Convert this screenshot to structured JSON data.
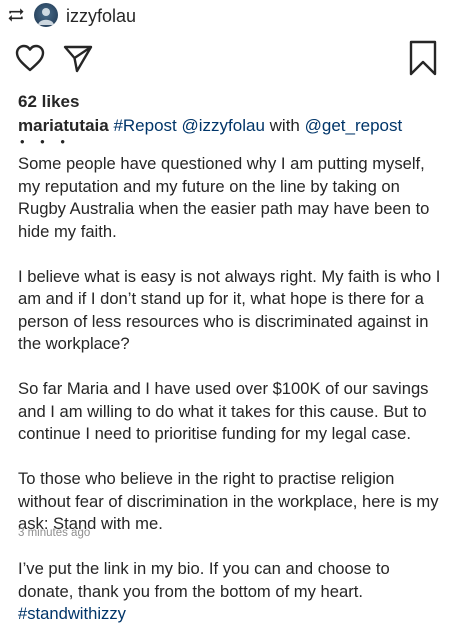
{
  "header": {
    "repost_icon": "repost-icon",
    "username": "izzyfolau"
  },
  "actions": {
    "like_icon": "heart-icon",
    "share_icon": "send-icon",
    "save_icon": "bookmark-icon"
  },
  "likes": "62 likes",
  "caption": {
    "user": "mariatutaia",
    "tag1": "#Repost",
    "mention1": "@izzyfolau",
    "with_text": "with",
    "mention2": "@get_repost",
    "more": "• • •",
    "paragraphs": [
      "Some people have questioned why I am putting myself, my reputation and my future on the line by taking on Rugby Australia when the easier path may have been to hide my faith.",
      "I believe what is easy is not always right. My faith is who I am and if I don’t stand up for it, what hope is there for a person of less resources who is discriminated against in the workplace?",
      "So far Maria and I have used over $100K of our savings and I am willing to do what it takes for this cause. But to continue I need to prioritise funding for my legal case.",
      "To those who believe in the right to practise religion without fear of discrimination in the workplace, here is my ask: Stand with me."
    ],
    "last_paragraph": "I’ve put the link in my bio. If you can and choose to donate, thank you from the bottom of my heart.",
    "hashtag": "#standwithizzy"
  },
  "timestamp": "3 minutes ago",
  "colors": {
    "text": "#262626",
    "link": "#003569",
    "muted": "#8e8e8e"
  }
}
